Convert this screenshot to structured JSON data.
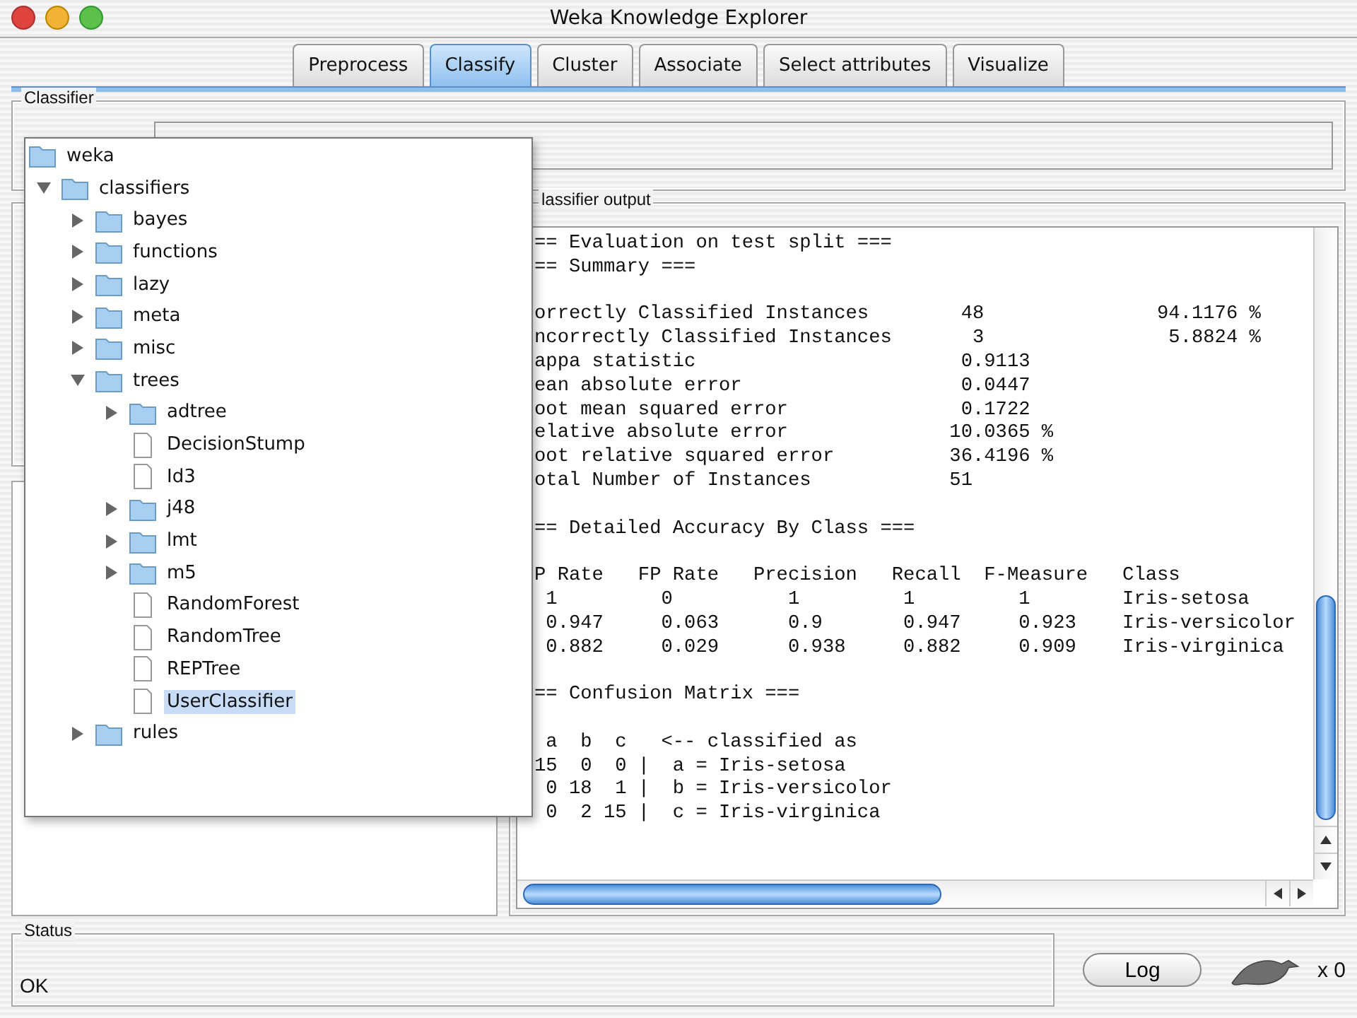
{
  "window": {
    "title": "Weka Knowledge Explorer"
  },
  "tabs": [
    {
      "label": "Preprocess",
      "selected": false
    },
    {
      "label": "Classify",
      "selected": true
    },
    {
      "label": "Cluster",
      "selected": false
    },
    {
      "label": "Associate",
      "selected": false
    },
    {
      "label": "Select attributes",
      "selected": false
    },
    {
      "label": "Visualize",
      "selected": false
    }
  ],
  "classifier": {
    "title": "Classifier"
  },
  "tree": {
    "label": "weka",
    "children": [
      {
        "label": "classifiers",
        "kind": "folder",
        "expanded": true,
        "selected": false,
        "children": [
          {
            "label": "bayes",
            "kind": "folder",
            "expanded": false,
            "selected": false
          },
          {
            "label": "functions",
            "kind": "folder",
            "expanded": false,
            "selected": false
          },
          {
            "label": "lazy",
            "kind": "folder",
            "expanded": false,
            "selected": false
          },
          {
            "label": "meta",
            "kind": "folder",
            "expanded": false,
            "selected": false
          },
          {
            "label": "misc",
            "kind": "folder",
            "expanded": false,
            "selected": false
          },
          {
            "label": "trees",
            "kind": "folder",
            "expanded": true,
            "selected": false,
            "children": [
              {
                "label": "adtree",
                "kind": "folder",
                "expanded": false,
                "selected": false
              },
              {
                "label": "DecisionStump",
                "kind": "leaf",
                "selected": false
              },
              {
                "label": "Id3",
                "kind": "leaf",
                "selected": false
              },
              {
                "label": "j48",
                "kind": "folder",
                "expanded": false,
                "selected": false
              },
              {
                "label": "lmt",
                "kind": "folder",
                "expanded": false,
                "selected": false
              },
              {
                "label": "m5",
                "kind": "folder",
                "expanded": false,
                "selected": false
              },
              {
                "label": "RandomForest",
                "kind": "leaf",
                "selected": false
              },
              {
                "label": "RandomTree",
                "kind": "leaf",
                "selected": false
              },
              {
                "label": "REPTree",
                "kind": "leaf",
                "selected": false
              },
              {
                "label": "UserClassifier",
                "kind": "leaf",
                "selected": true
              }
            ]
          },
          {
            "label": "rules",
            "kind": "folder",
            "expanded": false,
            "selected": false
          }
        ]
      }
    ]
  },
  "output": {
    "title": "lassifier output",
    "blocks": [
      [
        "== Evaluation on test split ===",
        "== Summary ==="
      ],
      [
        "orrectly Classified Instances        48               94.1176 %",
        "ncorrectly Classified Instances       3                5.8824 %",
        "appa statistic                       0.9113",
        "ean absolute error                   0.0447",
        "oot mean squared error               0.1722",
        "elative absolute error              10.0365 %",
        "oot relative squared error          36.4196 %",
        "otal Number of Instances            51"
      ],
      [
        "== Detailed Accuracy By Class ==="
      ],
      [
        "P Rate   FP Rate   Precision   Recall  F-Measure   Class",
        " 1         0          1         1         1        Iris-setosa",
        " 0.947     0.063      0.9       0.947     0.923    Iris-versicolor",
        " 0.882     0.029      0.938     0.882     0.909    Iris-virginica"
      ],
      [
        "== Confusion Matrix ==="
      ],
      [
        " a  b  c   <-- classified as",
        "15  0  0 |  a = Iris-setosa",
        " 0 18  1 |  b = Iris-versicolor",
        " 0  2 15 |  c = Iris-virginica"
      ]
    ]
  },
  "status": {
    "title": "Status",
    "message": "OK"
  },
  "log_button": "Log",
  "task_count": "x 0"
}
